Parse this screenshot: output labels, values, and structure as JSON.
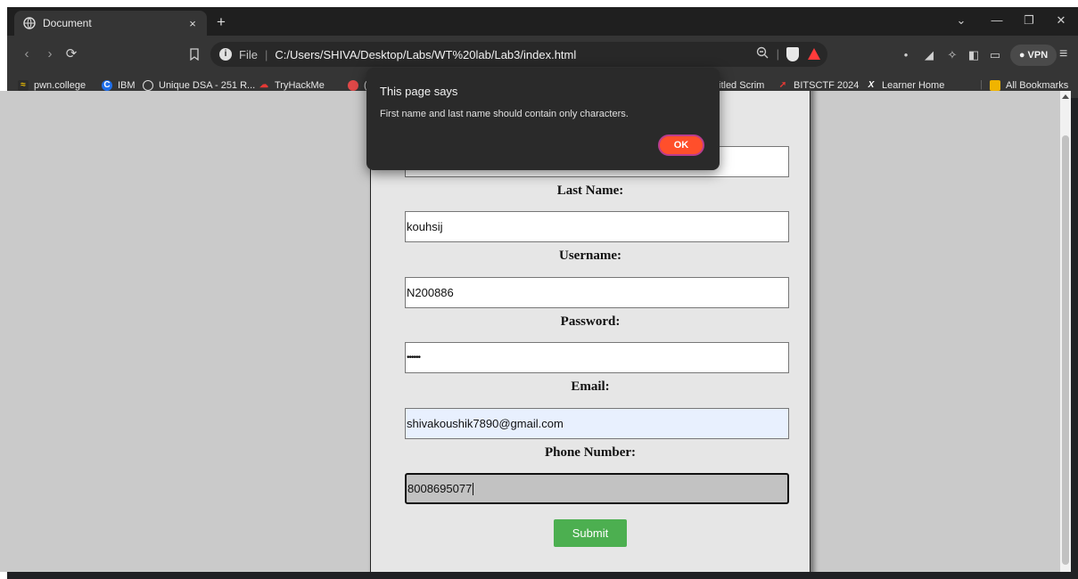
{
  "browser": {
    "tab_title": "Document",
    "tab_close": "×",
    "new_tab": "+",
    "nav": {
      "back": "‹",
      "forward": "›",
      "reload": "⟳"
    },
    "omnibox": {
      "scheme": "File",
      "separator": "|",
      "url": "C:/Users/SHIVA/Desktop/Labs/WT%20lab/Lab3/index.html"
    },
    "vpn_label": "● VPN",
    "window_controls": {
      "chevron": "⌄",
      "minimize": "—",
      "restore": "❐",
      "close": "✕"
    }
  },
  "bookmarks": [
    {
      "label": "pwn.college",
      "icon": "pwn-icon"
    },
    {
      "label": "IBM",
      "icon": "ibm-icon"
    },
    {
      "label": "Unique DSA - 251 R...",
      "icon": "globe-icon"
    },
    {
      "label": "TryHackMe",
      "icon": "tryhackme-icon"
    },
    {
      "label": "(",
      "icon": "bookmark-icon"
    },
    {
      "label": "itled Scrim",
      "icon": ""
    },
    {
      "label": "BITSCTF 2024",
      "icon": "bitsctf-icon"
    },
    {
      "label": "Learner Home",
      "icon": "x-icon"
    },
    {
      "label": "All Bookmarks",
      "icon": "folder-icon"
    }
  ],
  "form": {
    "last_name_label": "Last Name:",
    "last_name_value": "kouhsij",
    "username_label": "Username:",
    "username_value": "N200886",
    "password_label": "Password:",
    "password_value": "••••••",
    "email_label": "Email:",
    "email_value": "shivakoushik7890@gmail.com",
    "phone_label": "Phone Number:",
    "phone_value": "8008695077",
    "submit_label": "Submit"
  },
  "dialog": {
    "title": "This page says",
    "message": "First name and last name should contain only characters.",
    "ok_label": "OK"
  },
  "colors": {
    "submit": "#4caf50",
    "ok_button": "#ff4f2b",
    "page_background": "#cacaca"
  }
}
